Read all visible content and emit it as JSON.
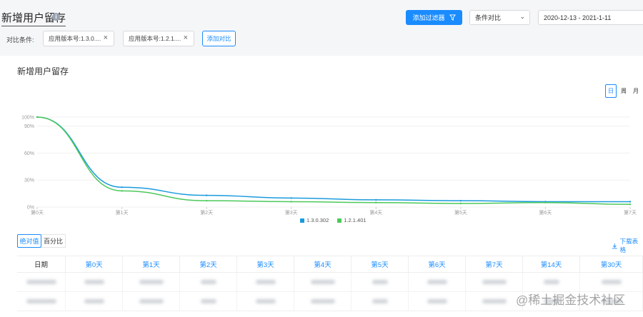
{
  "header": {
    "title": "新增用户留存",
    "info_icon": "info-icon",
    "add_filter_label": "添加过滤器",
    "compare_select": "条件对比",
    "date_range": "2020-12-13 - 2021-1-11"
  },
  "compare": {
    "label": "对比条件:",
    "tags": [
      "应用版本号:1.3.0....",
      "应用版本号:1.2.1...."
    ],
    "add_label": "添加对比"
  },
  "card": {
    "title": "新增用户留存",
    "granularity": [
      "日",
      "周",
      "月"
    ],
    "active_granularity": "日"
  },
  "chart_data": {
    "type": "line",
    "x": [
      "第0天",
      "第1天",
      "第2天",
      "第3天",
      "第4天",
      "第5天",
      "第6天",
      "第7天"
    ],
    "y_ticks": [
      "100%",
      "90%",
      "60%",
      "30%",
      "0%"
    ],
    "ylim": [
      0,
      100
    ],
    "series": [
      {
        "name": "1.3.0.302",
        "color": "#1a9bdc",
        "values": [
          100,
          22,
          13,
          10,
          8,
          7,
          6,
          6
        ]
      },
      {
        "name": "1.2.1.401",
        "color": "#4cc95a",
        "values": [
          100,
          18,
          7,
          6,
          5,
          4,
          5,
          3
        ]
      }
    ]
  },
  "table": {
    "toggle_absolute": "绝对值",
    "toggle_percent": "百分比",
    "download_label": "下载表格",
    "columns": [
      "日期",
      "第0天",
      "第1天",
      "第2天",
      "第3天",
      "第4天",
      "第5天",
      "第6天",
      "第7天",
      "第14天",
      "第30天"
    ]
  },
  "watermark": "@稀土掘金技术社区"
}
